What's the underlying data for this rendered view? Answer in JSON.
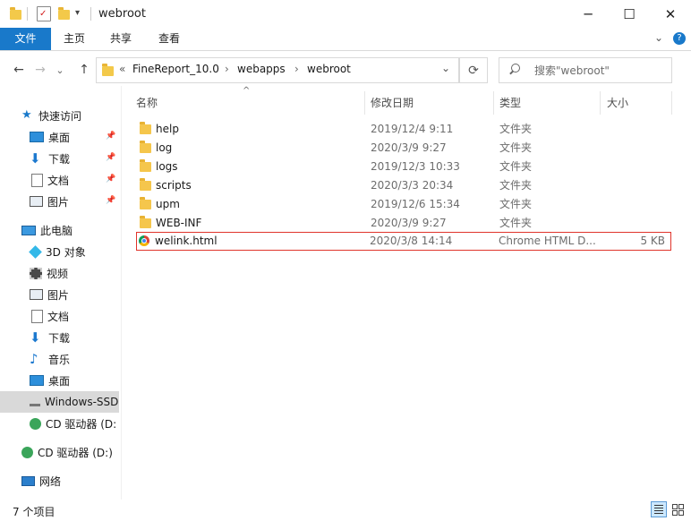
{
  "window": {
    "title": "webroot",
    "minimize": "─",
    "maximize": "☐",
    "close": "✕"
  },
  "ribbon": {
    "tabs": [
      "文件",
      "主页",
      "共享",
      "查看"
    ],
    "expand": "⌄",
    "help": "?"
  },
  "nav_buttons": {
    "back": "←",
    "forward": "→",
    "recent": "⌄",
    "up": "↑"
  },
  "address": {
    "prefix": "«",
    "crumbs": [
      "FineReport_10.0",
      "webapps",
      "webroot"
    ],
    "sep": "›",
    "dropdown": "⌄"
  },
  "search": {
    "placeholder": "搜索\"webroot\""
  },
  "sidebar": {
    "items": [
      {
        "label": "快速访问",
        "icon": "star-icon",
        "pinned": false
      },
      {
        "label": "桌面",
        "icon": "desktop-icon",
        "pinned": true
      },
      {
        "label": "下载",
        "icon": "download-icon",
        "pinned": true
      },
      {
        "label": "文档",
        "icon": "document-icon",
        "pinned": true
      },
      {
        "label": "图片",
        "icon": "picture-icon",
        "pinned": true
      },
      {
        "label": "此电脑",
        "icon": "computer-icon",
        "pinned": false
      },
      {
        "label": "3D 对象",
        "icon": "cube-icon",
        "pinned": false
      },
      {
        "label": "视频",
        "icon": "video-icon",
        "pinned": false
      },
      {
        "label": "图片",
        "icon": "picture-icon",
        "pinned": false
      },
      {
        "label": "文档",
        "icon": "document-icon",
        "pinned": false
      },
      {
        "label": "下载",
        "icon": "download-icon",
        "pinned": false
      },
      {
        "label": "音乐",
        "icon": "music-icon",
        "pinned": false
      },
      {
        "label": "桌面",
        "icon": "desktop-icon",
        "pinned": false
      },
      {
        "label": "Windows-SSD",
        "icon": "drive-icon",
        "pinned": false
      },
      {
        "label": "CD 驱动器 (D:",
        "icon": "cd-drive-icon",
        "pinned": false
      },
      {
        "label": "CD 驱动器 (D:)",
        "icon": "cd-drive-icon",
        "pinned": false
      },
      {
        "label": "网络",
        "icon": "network-icon",
        "pinned": false
      }
    ]
  },
  "columns": {
    "name": "名称",
    "date": "修改日期",
    "type": "类型",
    "size": "大小",
    "sort_indicator": "^"
  },
  "files": [
    {
      "name": "help",
      "date": "2019/12/4 9:11",
      "type": "文件夹",
      "size": "",
      "icon": "folder-icon"
    },
    {
      "name": "log",
      "date": "2020/3/9 9:27",
      "type": "文件夹",
      "size": "",
      "icon": "folder-icon"
    },
    {
      "name": "logs",
      "date": "2019/12/3 10:33",
      "type": "文件夹",
      "size": "",
      "icon": "folder-icon"
    },
    {
      "name": "scripts",
      "date": "2020/3/3 20:34",
      "type": "文件夹",
      "size": "",
      "icon": "folder-icon"
    },
    {
      "name": "upm",
      "date": "2019/12/6 15:34",
      "type": "文件夹",
      "size": "",
      "icon": "folder-icon"
    },
    {
      "name": "WEB-INF",
      "date": "2020/3/9 9:27",
      "type": "文件夹",
      "size": "",
      "icon": "folder-icon"
    },
    {
      "name": "welink.html",
      "date": "2020/3/8 14:14",
      "type": "Chrome HTML D...",
      "size": "5 KB",
      "icon": "chrome-icon",
      "highlighted": true
    }
  ],
  "status": {
    "item_count": "7 个项目"
  },
  "colors": {
    "accent": "#1979ca",
    "highlight_border": "#e0342b",
    "selected_nav": "#cce8ff",
    "folder": "#f5c64c"
  }
}
